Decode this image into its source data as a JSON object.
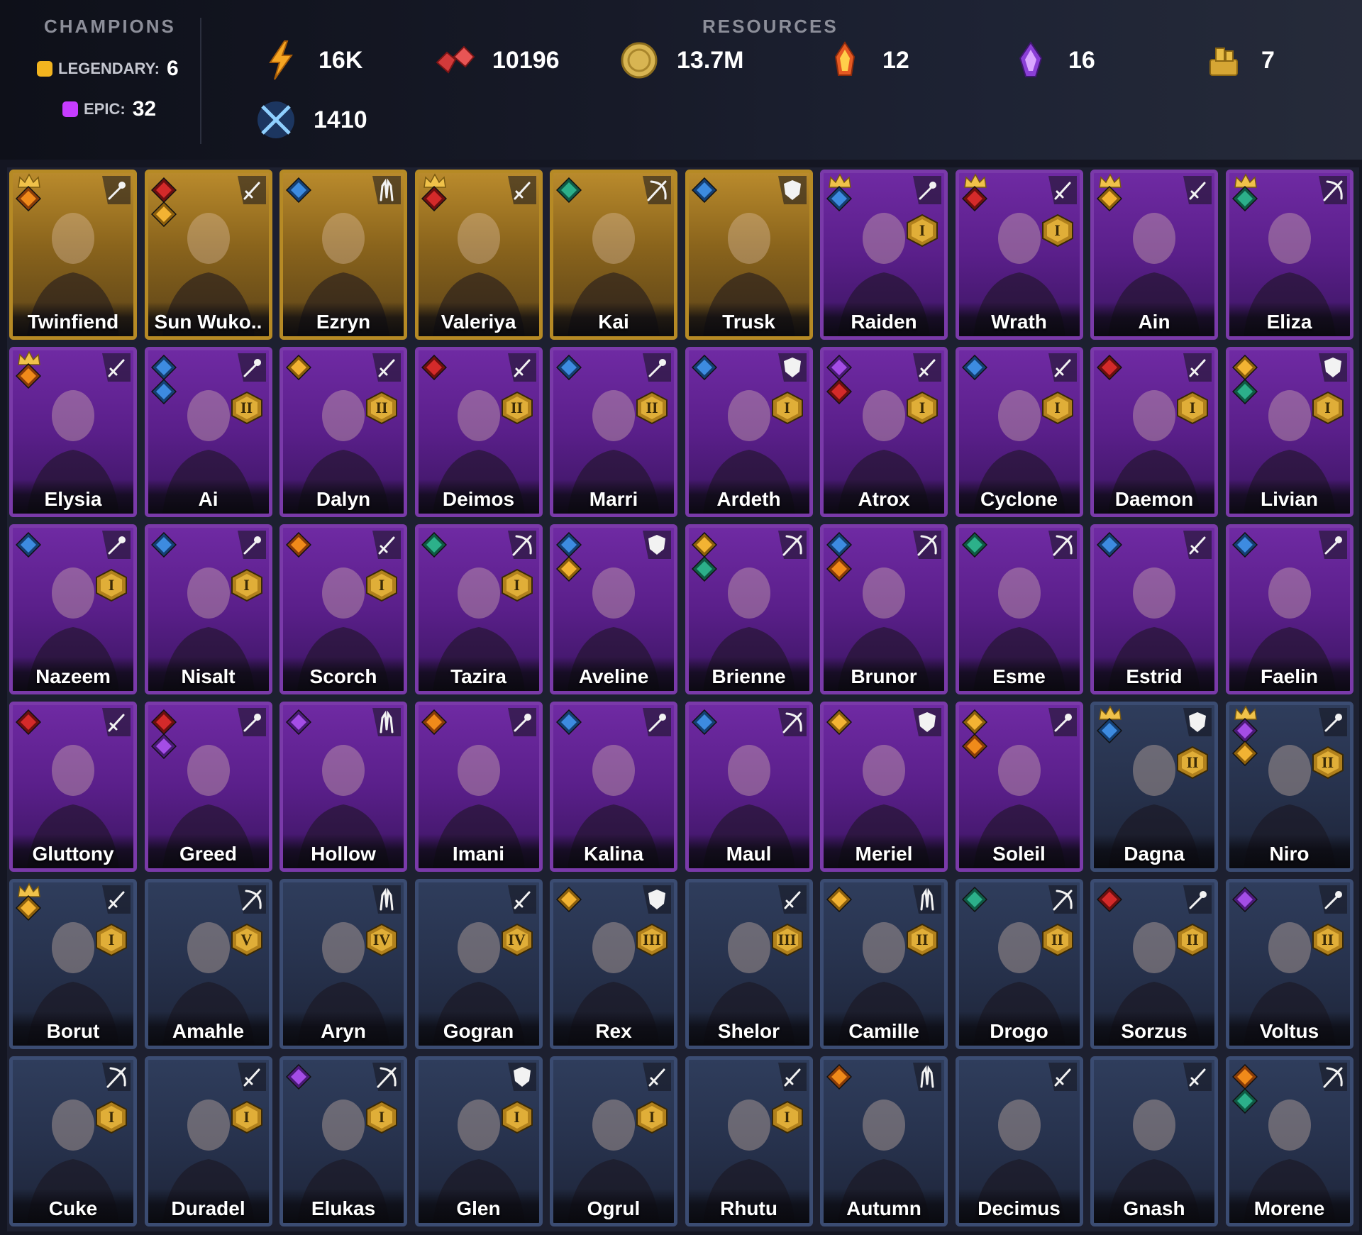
{
  "header": {
    "champions_title": "CHAMPIONS",
    "resources_title": "RESOURCES",
    "rarity": [
      {
        "label": "LEGENDARY:",
        "count": "6",
        "color": "#f2b41f"
      },
      {
        "label": "EPIC:",
        "count": "32",
        "color": "#c63cff"
      }
    ],
    "resources": [
      {
        "icon": "lightning-energy-icon",
        "value": "16K"
      },
      {
        "icon": "red-gems-icon",
        "value": "10196"
      },
      {
        "icon": "gold-coin-icon",
        "value": "13.7M"
      },
      {
        "icon": "fire-shard-icon",
        "value": "12"
      },
      {
        "icon": "purple-shard-icon",
        "value": "16"
      },
      {
        "icon": "gold-pile-icon",
        "value": "7"
      },
      {
        "icon": "crossed-swords-icon",
        "value": "1410"
      }
    ]
  },
  "colors": {
    "legendary_border": "#b68a25",
    "epic_border": "#7a3aa9",
    "rare_border": "#3b4c72",
    "background": "#141622"
  },
  "champions": [
    {
      "name": "Twinfiend",
      "rarity": "legendary",
      "role": "magic",
      "factions": [
        "flame"
      ],
      "crown": true,
      "rank": ""
    },
    {
      "name": "Sun Wuko..",
      "rarity": "legendary",
      "role": "sword",
      "factions": [
        "blood",
        "sun"
      ],
      "crown": false,
      "rank": ""
    },
    {
      "name": "Ezryn",
      "rarity": "legendary",
      "role": "support",
      "factions": [
        "water"
      ],
      "crown": false,
      "rank": ""
    },
    {
      "name": "Valeriya",
      "rarity": "legendary",
      "role": "sword",
      "factions": [
        "blood"
      ],
      "crown": true,
      "rank": ""
    },
    {
      "name": "Kai",
      "rarity": "legendary",
      "role": "bow",
      "factions": [
        "nature"
      ],
      "crown": false,
      "rank": ""
    },
    {
      "name": "Trusk",
      "rarity": "legendary",
      "role": "shield",
      "factions": [
        "water"
      ],
      "crown": false,
      "rank": ""
    },
    {
      "name": "Raiden",
      "rarity": "epic",
      "role": "magic",
      "factions": [
        "water"
      ],
      "crown": true,
      "rank": "I"
    },
    {
      "name": "Wrath",
      "rarity": "epic",
      "role": "sword",
      "factions": [
        "blood"
      ],
      "crown": true,
      "rank": "I"
    },
    {
      "name": "Ain",
      "rarity": "epic",
      "role": "sword",
      "factions": [
        "sun"
      ],
      "crown": true,
      "rank": ""
    },
    {
      "name": "Eliza",
      "rarity": "epic",
      "role": "bow",
      "factions": [
        "nature"
      ],
      "crown": true,
      "rank": ""
    },
    {
      "name": "Elysia",
      "rarity": "epic",
      "role": "sword",
      "factions": [
        "flame"
      ],
      "crown": true,
      "rank": ""
    },
    {
      "name": "Ai",
      "rarity": "epic",
      "role": "magic",
      "factions": [
        "water",
        "water"
      ],
      "crown": false,
      "rank": "II"
    },
    {
      "name": "Dalyn",
      "rarity": "epic",
      "role": "sword",
      "factions": [
        "sun"
      ],
      "crown": false,
      "rank": "II"
    },
    {
      "name": "Deimos",
      "rarity": "epic",
      "role": "sword",
      "factions": [
        "blood"
      ],
      "crown": false,
      "rank": "II"
    },
    {
      "name": "Marri",
      "rarity": "epic",
      "role": "magic",
      "factions": [
        "water"
      ],
      "crown": false,
      "rank": "II"
    },
    {
      "name": "Ardeth",
      "rarity": "epic",
      "role": "shield",
      "factions": [
        "water"
      ],
      "crown": false,
      "rank": "I"
    },
    {
      "name": "Atrox",
      "rarity": "epic",
      "role": "sword",
      "factions": [
        "void",
        "blood"
      ],
      "crown": false,
      "rank": "I"
    },
    {
      "name": "Cyclone",
      "rarity": "epic",
      "role": "sword",
      "factions": [
        "water"
      ],
      "crown": false,
      "rank": "I"
    },
    {
      "name": "Daemon",
      "rarity": "epic",
      "role": "sword",
      "factions": [
        "blood"
      ],
      "crown": false,
      "rank": "I"
    },
    {
      "name": "Livian",
      "rarity": "epic",
      "role": "shield",
      "factions": [
        "sun",
        "nature"
      ],
      "crown": false,
      "rank": "I"
    },
    {
      "name": "Nazeem",
      "rarity": "epic",
      "role": "magic",
      "factions": [
        "water"
      ],
      "crown": false,
      "rank": "I"
    },
    {
      "name": "Nisalt",
      "rarity": "epic",
      "role": "magic",
      "factions": [
        "water"
      ],
      "crown": false,
      "rank": "I"
    },
    {
      "name": "Scorch",
      "rarity": "epic",
      "role": "sword",
      "factions": [
        "flame"
      ],
      "crown": false,
      "rank": "I"
    },
    {
      "name": "Tazira",
      "rarity": "epic",
      "role": "bow",
      "factions": [
        "nature"
      ],
      "crown": false,
      "rank": "I"
    },
    {
      "name": "Aveline",
      "rarity": "epic",
      "role": "shield",
      "factions": [
        "water",
        "sun"
      ],
      "crown": false,
      "rank": ""
    },
    {
      "name": "Brienne",
      "rarity": "epic",
      "role": "bow",
      "factions": [
        "sun",
        "nature"
      ],
      "crown": false,
      "rank": ""
    },
    {
      "name": "Brunor",
      "rarity": "epic",
      "role": "bow",
      "factions": [
        "water",
        "flame"
      ],
      "crown": false,
      "rank": ""
    },
    {
      "name": "Esme",
      "rarity": "epic",
      "role": "bow",
      "factions": [
        "nature"
      ],
      "crown": false,
      "rank": ""
    },
    {
      "name": "Estrid",
      "rarity": "epic",
      "role": "sword",
      "factions": [
        "water"
      ],
      "crown": false,
      "rank": ""
    },
    {
      "name": "Faelin",
      "rarity": "epic",
      "role": "magic",
      "factions": [
        "water"
      ],
      "crown": false,
      "rank": ""
    },
    {
      "name": "Gluttony",
      "rarity": "epic",
      "role": "sword",
      "factions": [
        "blood"
      ],
      "crown": false,
      "rank": ""
    },
    {
      "name": "Greed",
      "rarity": "epic",
      "role": "magic",
      "factions": [
        "blood",
        "void"
      ],
      "crown": false,
      "rank": ""
    },
    {
      "name": "Hollow",
      "rarity": "epic",
      "role": "support",
      "factions": [
        "void"
      ],
      "crown": false,
      "rank": ""
    },
    {
      "name": "Imani",
      "rarity": "epic",
      "role": "magic",
      "factions": [
        "flame"
      ],
      "crown": false,
      "rank": ""
    },
    {
      "name": "Kalina",
      "rarity": "epic",
      "role": "magic",
      "factions": [
        "water"
      ],
      "crown": false,
      "rank": ""
    },
    {
      "name": "Maul",
      "rarity": "epic",
      "role": "bow",
      "factions": [
        "water"
      ],
      "crown": false,
      "rank": ""
    },
    {
      "name": "Meriel",
      "rarity": "epic",
      "role": "shield",
      "factions": [
        "sun"
      ],
      "crown": false,
      "rank": ""
    },
    {
      "name": "Soleil",
      "rarity": "epic",
      "role": "magic",
      "factions": [
        "sun",
        "flame"
      ],
      "crown": false,
      "rank": ""
    },
    {
      "name": "Dagna",
      "rarity": "rare",
      "role": "shield",
      "factions": [
        "water"
      ],
      "crown": true,
      "rank": "II"
    },
    {
      "name": "Niro",
      "rarity": "rare",
      "role": "magic",
      "factions": [
        "void",
        "sun"
      ],
      "crown": true,
      "rank": "II"
    },
    {
      "name": "Borut",
      "rarity": "rare",
      "role": "sword",
      "factions": [
        "sun"
      ],
      "crown": true,
      "rank": "I"
    },
    {
      "name": "Amahle",
      "rarity": "rare",
      "role": "bow",
      "factions": [],
      "crown": false,
      "rank": "V"
    },
    {
      "name": "Aryn",
      "rarity": "rare",
      "role": "support",
      "factions": [],
      "crown": false,
      "rank": "IV"
    },
    {
      "name": "Gogran",
      "rarity": "rare",
      "role": "sword",
      "factions": [],
      "crown": false,
      "rank": "IV"
    },
    {
      "name": "Rex",
      "rarity": "rare",
      "role": "shield",
      "factions": [
        "sun"
      ],
      "crown": false,
      "rank": "III"
    },
    {
      "name": "Shelor",
      "rarity": "rare",
      "role": "sword",
      "factions": [],
      "crown": false,
      "rank": "III"
    },
    {
      "name": "Camille",
      "rarity": "rare",
      "role": "support",
      "factions": [
        "sun"
      ],
      "crown": false,
      "rank": "II"
    },
    {
      "name": "Drogo",
      "rarity": "rare",
      "role": "bow",
      "factions": [
        "nature"
      ],
      "crown": false,
      "rank": "II"
    },
    {
      "name": "Sorzus",
      "rarity": "rare",
      "role": "magic",
      "factions": [
        "blood"
      ],
      "crown": false,
      "rank": "II"
    },
    {
      "name": "Voltus",
      "rarity": "rare",
      "role": "magic",
      "factions": [
        "void"
      ],
      "crown": false,
      "rank": "II"
    },
    {
      "name": "Cuke",
      "rarity": "rare",
      "role": "bow",
      "factions": [],
      "crown": false,
      "rank": "I"
    },
    {
      "name": "Duradel",
      "rarity": "rare",
      "role": "sword",
      "factions": [],
      "crown": false,
      "rank": "I"
    },
    {
      "name": "Elukas",
      "rarity": "rare",
      "role": "bow",
      "factions": [
        "void"
      ],
      "crown": false,
      "rank": "I"
    },
    {
      "name": "Glen",
      "rarity": "rare",
      "role": "shield",
      "factions": [],
      "crown": false,
      "rank": "I"
    },
    {
      "name": "Ogrul",
      "rarity": "rare",
      "role": "sword",
      "factions": [],
      "crown": false,
      "rank": "I"
    },
    {
      "name": "Rhutu",
      "rarity": "rare",
      "role": "sword",
      "factions": [],
      "crown": false,
      "rank": "I"
    },
    {
      "name": "Autumn",
      "rarity": "rare",
      "role": "support",
      "factions": [
        "flame"
      ],
      "crown": false,
      "rank": ""
    },
    {
      "name": "Decimus",
      "rarity": "rare",
      "role": "sword",
      "factions": [],
      "crown": false,
      "rank": ""
    },
    {
      "name": "Gnash",
      "rarity": "rare",
      "role": "sword",
      "factions": [],
      "crown": false,
      "rank": ""
    },
    {
      "name": "Morene",
      "rarity": "rare",
      "role": "bow",
      "factions": [
        "flame",
        "nature"
      ],
      "crown": false,
      "rank": ""
    }
  ]
}
